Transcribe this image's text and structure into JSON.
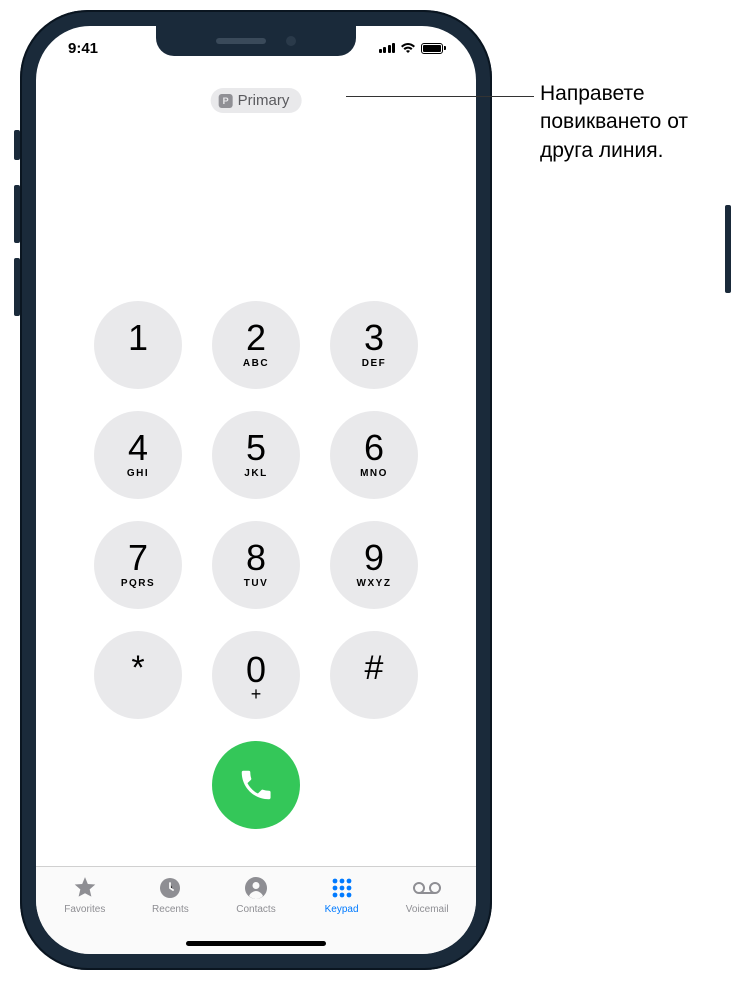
{
  "statusbar": {
    "time": "9:41"
  },
  "line_selector": {
    "badge": "P",
    "label": "Primary"
  },
  "keypad": {
    "rows": [
      [
        {
          "digit": "1",
          "letters": ""
        },
        {
          "digit": "2",
          "letters": "ABC"
        },
        {
          "digit": "3",
          "letters": "DEF"
        }
      ],
      [
        {
          "digit": "4",
          "letters": "GHI"
        },
        {
          "digit": "5",
          "letters": "JKL"
        },
        {
          "digit": "6",
          "letters": "MNO"
        }
      ],
      [
        {
          "digit": "7",
          "letters": "PQRS"
        },
        {
          "digit": "8",
          "letters": "TUV"
        },
        {
          "digit": "9",
          "letters": "WXYZ"
        }
      ],
      [
        {
          "digit": "*",
          "letters": "",
          "symbol": true
        },
        {
          "digit": "0",
          "letters": "+",
          "zero": true
        },
        {
          "digit": "#",
          "letters": "",
          "symbol": true
        }
      ]
    ]
  },
  "tabs": {
    "favorites": "Favorites",
    "recents": "Recents",
    "contacts": "Contacts",
    "keypad": "Keypad",
    "voicemail": "Voicemail"
  },
  "callout": {
    "text": "Направете повикването от друга линия."
  }
}
